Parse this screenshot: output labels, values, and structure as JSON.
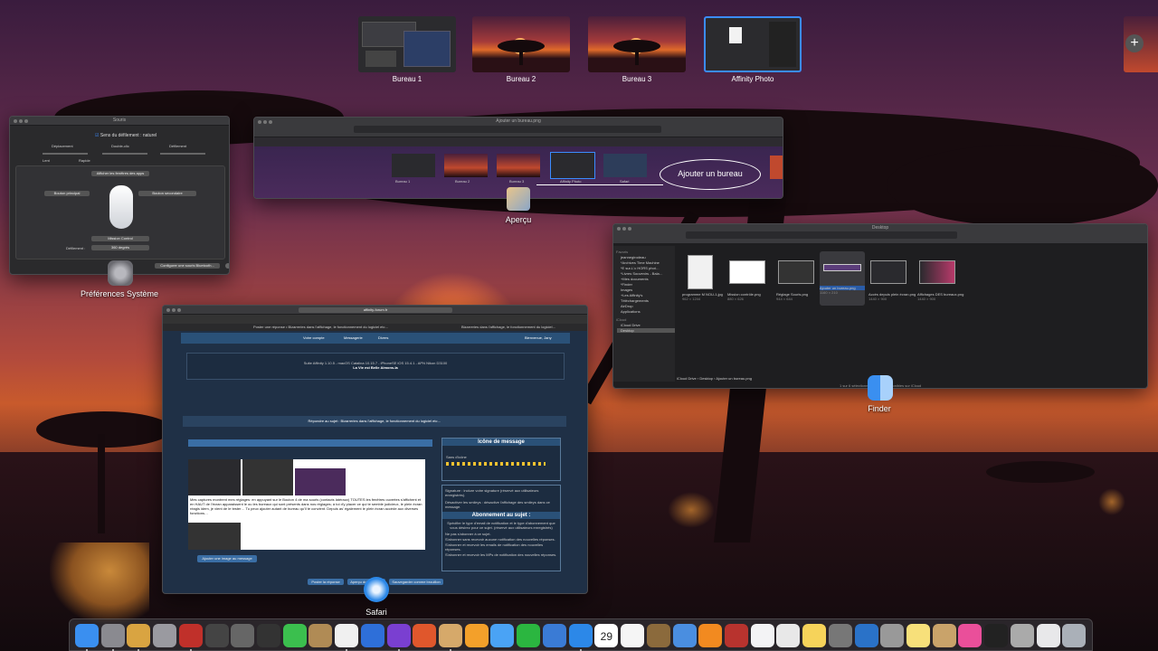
{
  "spaces": [
    {
      "label": "Bureau 1",
      "kind": "desktop-windows"
    },
    {
      "label": "Bureau 2",
      "kind": "sunset"
    },
    {
      "label": "Bureau 3",
      "kind": "sunset"
    },
    {
      "label": "Affinity Photo",
      "kind": "fullscreen-app",
      "selected": true
    }
  ],
  "add_space_icon": "plus-icon",
  "windows": {
    "preferences": {
      "app_label": "Préférences Système",
      "title": "Souris",
      "natural_scroll": "Sens du défilement : naturel",
      "tracking_label": "Déplacement",
      "double_click_label": "Double-clic",
      "scroll_label": "Défilement",
      "slow": "Lent",
      "fast": "Rapide",
      "show_all_apps": "Afficher les fenêtres des apps",
      "primary_button": "Bouton principal",
      "secondary_button": "Bouton secondaire",
      "mission_control": "Mission Control",
      "scroll_option": "360 degrés",
      "scroll_option_label": "Défilement :",
      "bluetooth_button": "Configurer une souris Bluetooth..."
    },
    "preview": {
      "app_label": "Aperçu",
      "title": "Ajouter un bureau.png",
      "callout": "Ajouter un bureau",
      "mini_spaces": [
        "Bureau 1",
        "Bureau 2",
        "Bureau 3",
        "Affinity Photo",
        "Safari"
      ]
    },
    "finder": {
      "app_label": "Finder",
      "title": "Desktop",
      "sidebar_favorites_header": "Favoris",
      "sidebar_favorites": [
        "jeannegirodeau",
        "*Archives Time Machine",
        "*E sur-L'c HORS phot…",
        "*Livres Souvenirs - Bala…",
        "+Mes documents",
        "*Finder",
        "Images",
        "+Les Affinity's",
        "Téléchargements",
        "AirDrop",
        "Applications"
      ],
      "sidebar_icloud_header": "iCloud",
      "sidebar_icloud": [
        "iCloud Drive",
        "Desktop"
      ],
      "files": [
        {
          "name": "programme M NOU-1.jpg",
          "meta": "962 × 1244"
        },
        {
          "name": "Mission contrôle.png",
          "meta": "880 × 626"
        },
        {
          "name": "Réglage Souris.png",
          "meta": "944 × 644"
        },
        {
          "name": "Ajouter un bureau.png",
          "meta": "1160 × 210",
          "selected": true
        },
        {
          "name": "Accès depuis plein écran.png",
          "meta": "1440 × 900"
        },
        {
          "name": "Affichages DES bureaux.png",
          "meta": "1440 × 900"
        }
      ],
      "path": [
        "iCloud Drive",
        "Desktop",
        "Ajouter un bureau.png"
      ],
      "status": "1 sur 6 sélectionné, 4,66 Go disponibles sur iCloud"
    },
    "safari": {
      "app_label": "Safari",
      "url": "affinity-forum.fr",
      "tab_left": "Poster une réponse • Bizarreries dans l'affichage, le fonctionnement du logiciel etc…",
      "tab_right": "Bizarreries dans l'affichage, le fonctionnement du logiciel…",
      "forum_nav": [
        "Votre compte",
        "Messagerie",
        "Divers"
      ],
      "forum_user": "Bienvenue, Jany",
      "signature_line1": "Suite Affinity 1.10.5 - macOS Catalina 10.15.7 - iPhoneSE iOS 15.4.1 - APN Nikon D3100",
      "signature_line2": "La Vie est Belle Aimons-la",
      "reply_title": "Répondre au sujet : Bizarreries dans l'affichage, le fonctionnement du logiciel etc…",
      "message_text": "Mes captures montrent mes réglages: en appuyant sur le Bouton 4 de ma souris (contacts latéraux) TOUTES les fenêtres ouvertes s'affichent et en HAUT de l'écran apparaissent le ou les bureaux qui sont présents dans nos réglages; à toi d'y placer ce qui te semble judicieux, le plein écran réagis idem, je vient de le tester… Tu peux ajouter autant de bureau qu'il te convient. Depuis as' également le plein écran accède aux diverses fonctions…",
      "add_image_button": "Ajouter une image au message",
      "icon_panel_title": "Icône de message",
      "icon_panel_none": "Sans d'icône",
      "signature_option": "Signature : inclure votre signature (réservé aux utilisateurs enregistrés).",
      "smileys_option": "Désactiver les smileys : désactive l'affichage des smileys dans ce message.",
      "subscription_title": "Abonnement au sujet :",
      "subscription_desc": "Spécifier le type d'email de notification et le type d'abonnement que vous désirez pour ce sujet. (réservé aux utilisateurs enregistrés)",
      "subscription_options": [
        "Ne pas s'abonner à ce sujet.",
        "S'abonner sans recevoir aucune notification des nouvelles réponses.",
        "S'abonner et recevoir les emails de notification des nouvelles réponses.",
        "S'abonner et recevoir les MPs de notification des nouvelles réponses."
      ],
      "post_button": "Poster la réponse",
      "preview_button": "Aperçu du message",
      "draft_button": "Sauvegarder comme brouillon"
    }
  },
  "dock": {
    "apps": [
      {
        "name": "finder-icon",
        "color": "#3a8ff0",
        "running": true
      },
      {
        "name": "system-preferences-icon",
        "color": "#8a8a90",
        "running": true
      },
      {
        "name": "keychain-icon",
        "color": "#d9a441",
        "running": true
      },
      {
        "name": "disk-utility-icon",
        "color": "#9a9aa0",
        "running": false
      },
      {
        "name": "photo-booth-icon",
        "color": "#c0302a",
        "running": true
      },
      {
        "name": "calculator-icon",
        "color": "#444",
        "running": false
      },
      {
        "name": "screenshot-icon",
        "color": "#666",
        "running": false
      },
      {
        "name": "console-icon",
        "color": "#333",
        "running": false
      },
      {
        "name": "facetime-icon",
        "color": "#3bbf4e",
        "running": false
      },
      {
        "name": "archive-icon",
        "color": "#b08b55",
        "running": false
      },
      {
        "name": "photos-icon",
        "color": "#f0f0f0",
        "running": true
      },
      {
        "name": "affinity-designer-icon",
        "color": "#2e6fd9",
        "running": false
      },
      {
        "name": "affinity-photo-icon",
        "color": "#7a3fd1",
        "running": true
      },
      {
        "name": "affinity-publisher-icon",
        "color": "#e0572c",
        "running": false
      },
      {
        "name": "preview-icon",
        "color": "#d6a96a",
        "running": true
      },
      {
        "name": "pages-icon",
        "color": "#f3a02a",
        "running": false
      },
      {
        "name": "messages-icon",
        "color": "#4aa3f5",
        "running": false
      },
      {
        "name": "whatsapp-icon",
        "color": "#2bb640",
        "running": false
      },
      {
        "name": "image-editor-icon",
        "color": "#3a7bd5",
        "running": false
      },
      {
        "name": "safari-icon",
        "color": "#2c88e8",
        "running": true
      },
      {
        "name": "calendar-icon",
        "color": "#ffffff",
        "running": false
      },
      {
        "name": "reminders-icon",
        "color": "#f5f5f5",
        "running": false
      },
      {
        "name": "notes-app-icon",
        "color": "#8b6a3c",
        "running": false
      },
      {
        "name": "keynote-icon",
        "color": "#4a8ee0",
        "running": false
      },
      {
        "name": "books-icon",
        "color": "#f28a20",
        "running": false
      },
      {
        "name": "news-icon",
        "color": "#b8332e",
        "running": false
      },
      {
        "name": "music-icon",
        "color": "#f3f3f5",
        "running": false
      },
      {
        "name": "textedit-icon",
        "color": "#e8e8e8",
        "running": false
      },
      {
        "name": "stickies-icon",
        "color": "#f6d35a",
        "running": false
      },
      {
        "name": "font-book-icon",
        "color": "#777",
        "running": false
      },
      {
        "name": "camera-icon",
        "color": "#2a72c8",
        "running": false
      },
      {
        "name": "automator-icon",
        "color": "#999",
        "running": false
      },
      {
        "name": "notes-icon",
        "color": "#f7e07a",
        "running": false
      },
      {
        "name": "packages-icon",
        "color": "#c9a36a",
        "running": false
      },
      {
        "name": "flickr-icon",
        "color": "#ea4f9a",
        "running": false
      },
      {
        "name": "activity-monitor-icon",
        "color": "#222",
        "running": false
      },
      {
        "name": "utility-icon",
        "color": "#aaa",
        "running": false
      },
      {
        "name": "downloads-icon",
        "color": "#e8e8ea",
        "running": false
      },
      {
        "name": "trash-icon",
        "color": "#aab0b8",
        "running": false
      }
    ]
  },
  "calendar_day": "29"
}
